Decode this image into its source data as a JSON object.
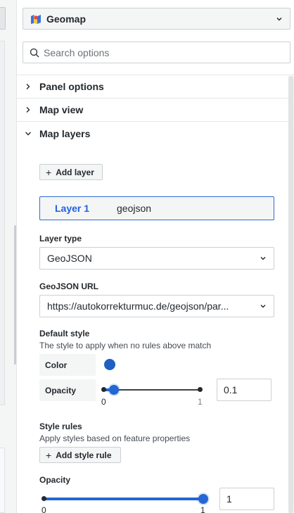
{
  "visualization": {
    "label": "Geomap",
    "icon": "geomap-icon"
  },
  "search": {
    "placeholder": "Search options",
    "value": ""
  },
  "sections": [
    {
      "title": "Panel options",
      "expanded": false
    },
    {
      "title": "Map view",
      "expanded": false
    },
    {
      "title": "Map layers",
      "expanded": true
    }
  ],
  "map_layers": {
    "add_layer_label": "Add layer",
    "layers": [
      {
        "name": "Layer 1",
        "type": "geojson",
        "selected": true
      }
    ],
    "layer_type": {
      "label": "Layer type",
      "value": "GeoJSON"
    },
    "geojson_url": {
      "label": "GeoJSON URL",
      "value": "https://autokorrekturmuc.de/geojson/par..."
    },
    "default_style": {
      "title": "Default style",
      "description": "The style to apply when no rules above match",
      "color": {
        "label": "Color",
        "value": "#1F60C4"
      },
      "opacity": {
        "label": "Opacity",
        "value": "0.1",
        "min_label": "0",
        "max_label": "1",
        "level": 0.1
      }
    },
    "style_rules": {
      "title": "Style rules",
      "description": "Apply styles based on feature properties",
      "add_label": "Add style rule"
    },
    "layer_opacity": {
      "label": "Opacity",
      "value": "1",
      "min_label": "0",
      "max_label": "1",
      "level": 1.0
    }
  },
  "colors": {
    "accent": "#2466D3",
    "selected_border": "#2E6BD6",
    "layer_name": "#1F62E0",
    "swatch": "#1F60C4"
  }
}
